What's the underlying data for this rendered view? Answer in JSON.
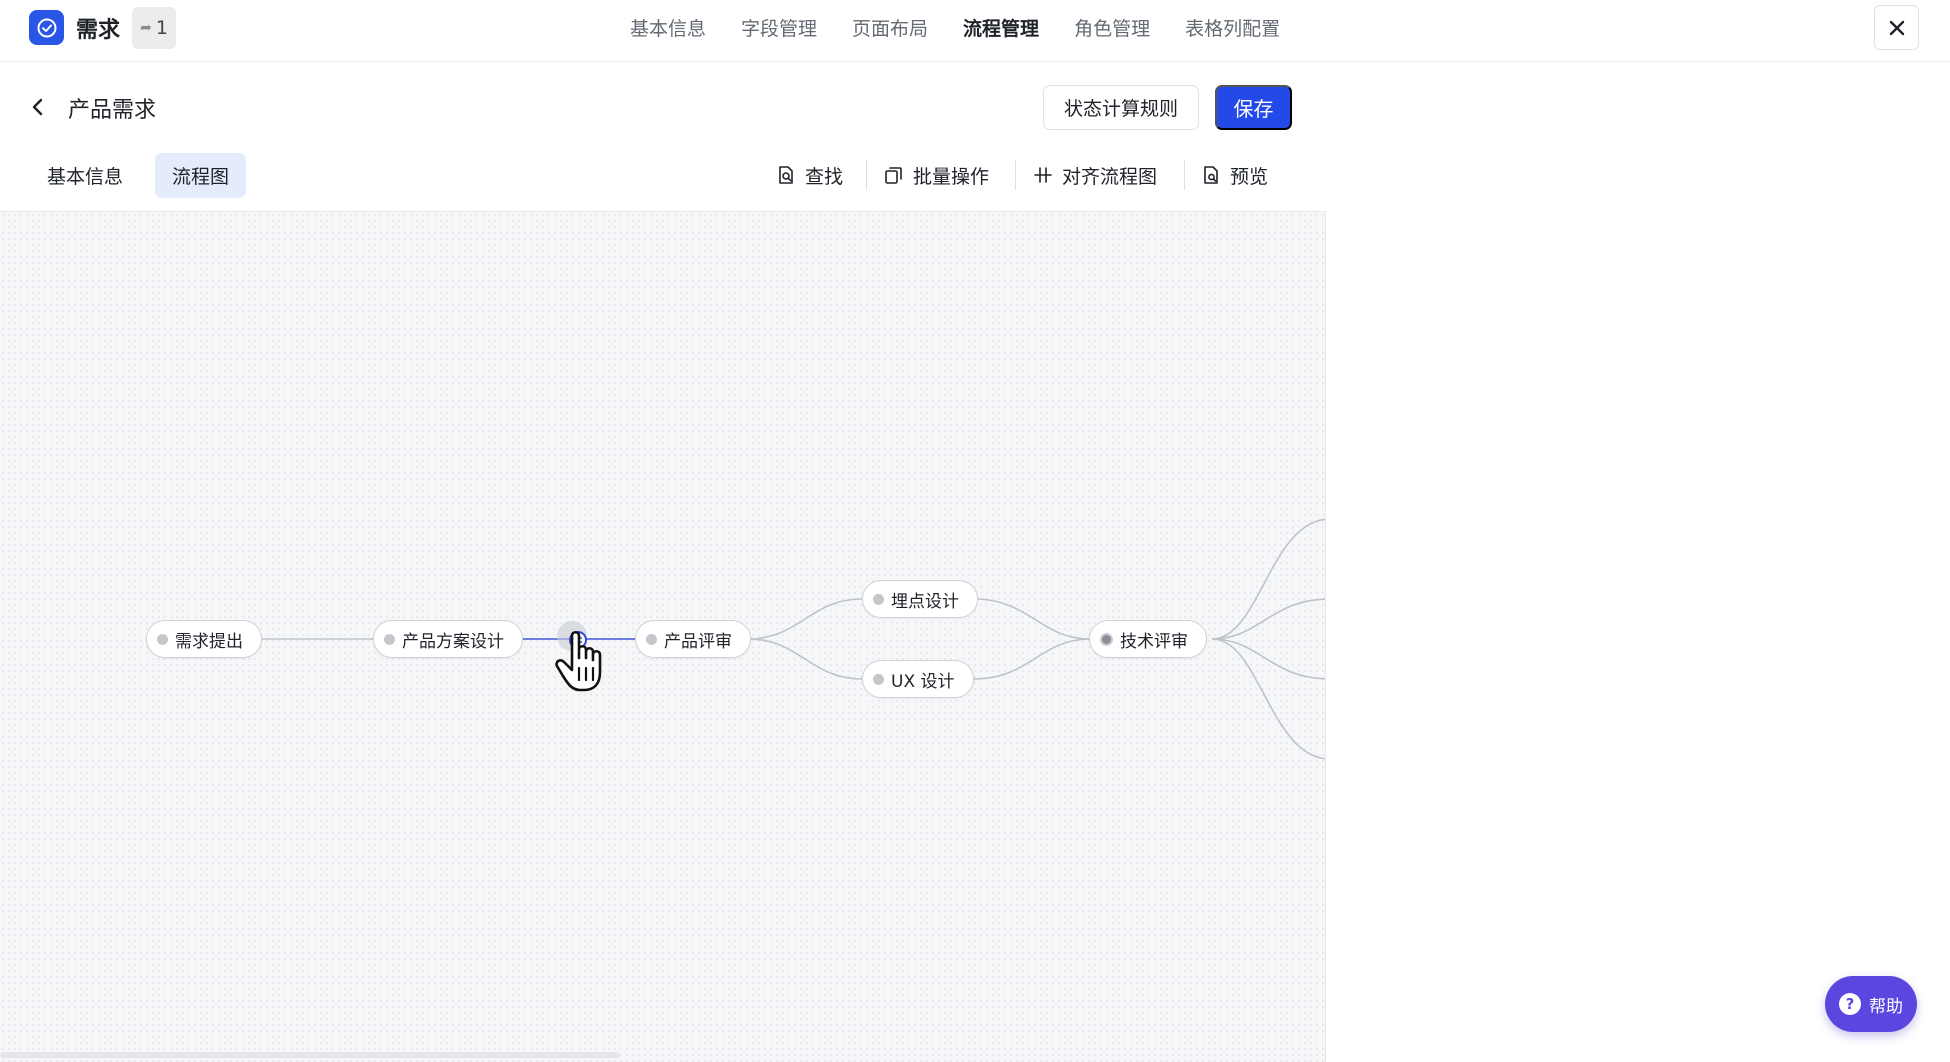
{
  "app": {
    "name": "需求",
    "share_count": "1"
  },
  "main_tabs": [
    {
      "label": "基本信息",
      "active": false
    },
    {
      "label": "字段管理",
      "active": false
    },
    {
      "label": "页面布局",
      "active": false
    },
    {
      "label": "流程管理",
      "active": true
    },
    {
      "label": "角色管理",
      "active": false
    },
    {
      "label": "表格列配置",
      "active": false
    }
  ],
  "page": {
    "title": "产品需求",
    "rules_button": "状态计算规则",
    "save_button": "保存"
  },
  "sub_tabs": [
    {
      "label": "基本信息",
      "active": false
    },
    {
      "label": "流程图",
      "active": true
    }
  ],
  "toolbar": {
    "find": "查找",
    "batch": "批量操作",
    "align": "对齐流程图",
    "preview": "预览"
  },
  "flow": {
    "nodes": [
      {
        "id": "n1",
        "label": "需求提出"
      },
      {
        "id": "n2",
        "label": "产品方案设计"
      },
      {
        "id": "n3",
        "label": "产品评审"
      },
      {
        "id": "n4",
        "label": "埋点设计"
      },
      {
        "id": "n5",
        "label": "UX 设计"
      },
      {
        "id": "n6",
        "label": "技术评审"
      }
    ]
  },
  "help": {
    "label": "帮助"
  },
  "colors": {
    "accent": "#2449e9",
    "help": "#5b47e0",
    "active_subtab": "#e4ebfb"
  }
}
